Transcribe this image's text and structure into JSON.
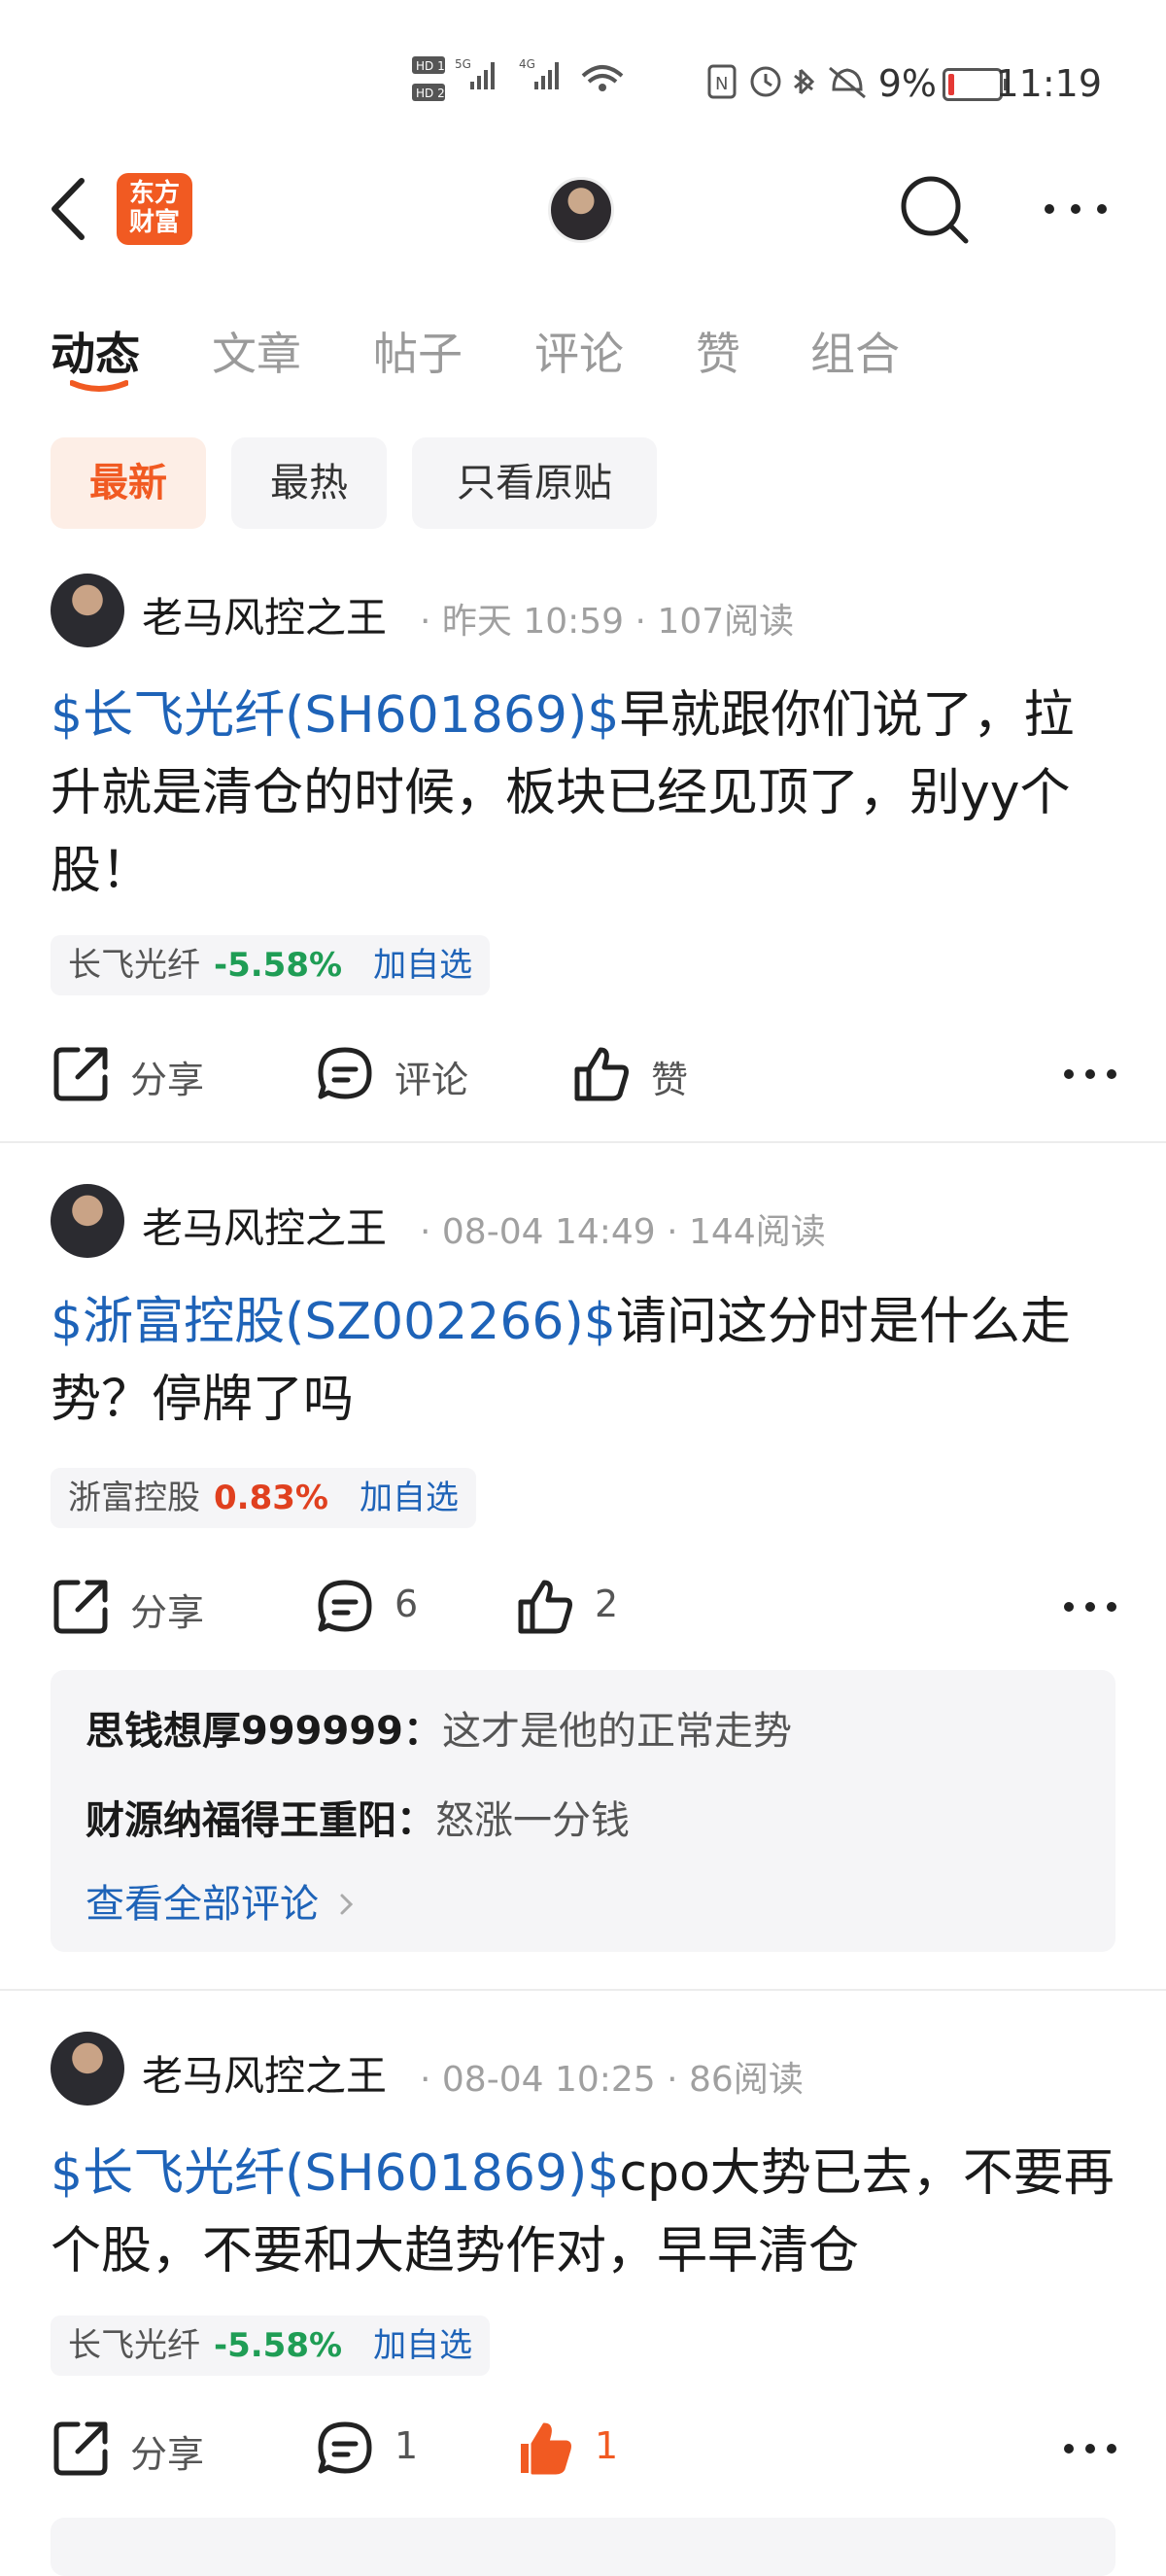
{
  "status_bar": {
    "time": "11:19",
    "battery_percent": "9%",
    "battery_level": 0.09,
    "battery_color": "#e53935",
    "sim_labels": [
      "HD 1",
      "HD 2"
    ],
    "network_labels": [
      "5G",
      "4G"
    ]
  },
  "nav": {
    "logo_line1": "东方",
    "logo_line2": "财富",
    "logo_color": "#f15a22"
  },
  "tabs": [
    {
      "label": "动态",
      "active": true
    },
    {
      "label": "文章",
      "active": false
    },
    {
      "label": "帖子",
      "active": false
    },
    {
      "label": "评论",
      "active": false
    },
    {
      "label": "赞",
      "active": false
    },
    {
      "label": "组合",
      "active": false
    }
  ],
  "filters": [
    {
      "label": "最新",
      "active": true
    },
    {
      "label": "最热",
      "active": false
    },
    {
      "label": "只看原贴",
      "active": false
    }
  ],
  "posts": [
    {
      "author": "老马风控之王",
      "time": "昨天 10:59",
      "reads": "107阅读",
      "stock_tag": "$长飞光纤(SH601869)$",
      "text": "早就跟你们说了，拉升就是清仓的时候，板块已经见顶了，别yy个股！",
      "stock_name": "长飞光纤",
      "stock_change": "-5.58%",
      "add_label": "加自选",
      "share_label": "分享",
      "comment_label": "评论",
      "like_label": "赞"
    },
    {
      "author": "老马风控之王",
      "time": "08-04 14:49",
      "reads": "144阅读",
      "stock_tag": "$浙富控股(SZ002266)$",
      "text": "请问这分时是什么走势？停牌了吗",
      "stock_name": "浙富控股",
      "stock_change": "0.83%",
      "add_label": "加自选",
      "share_label": "分享",
      "comment_label": "6",
      "like_label": "2",
      "comments": [
        {
          "name": "思钱想厚999999：",
          "text": "这才是他的正常走势"
        },
        {
          "name": "财源纳福得王重阳：",
          "text": "怒涨一分钱"
        }
      ],
      "view_all": "查看全部评论"
    },
    {
      "author": "老马风控之王",
      "time": "08-04 10:25",
      "reads": "86阅读",
      "stock_tag": "$长飞光纤(SH601869)$",
      "text": "cpo大势已去，不要再个股，不要和大趋势作对，早早清仓",
      "stock_name": "长飞光纤",
      "stock_change": "-5.58%",
      "add_label": "加自选",
      "share_label": "分享",
      "comment_label": "1",
      "like_label": "1"
    }
  ],
  "colors": {
    "accent": "#f15a22",
    "link": "#1e63b8",
    "down": "#1f9d55",
    "up": "#e0401f"
  }
}
